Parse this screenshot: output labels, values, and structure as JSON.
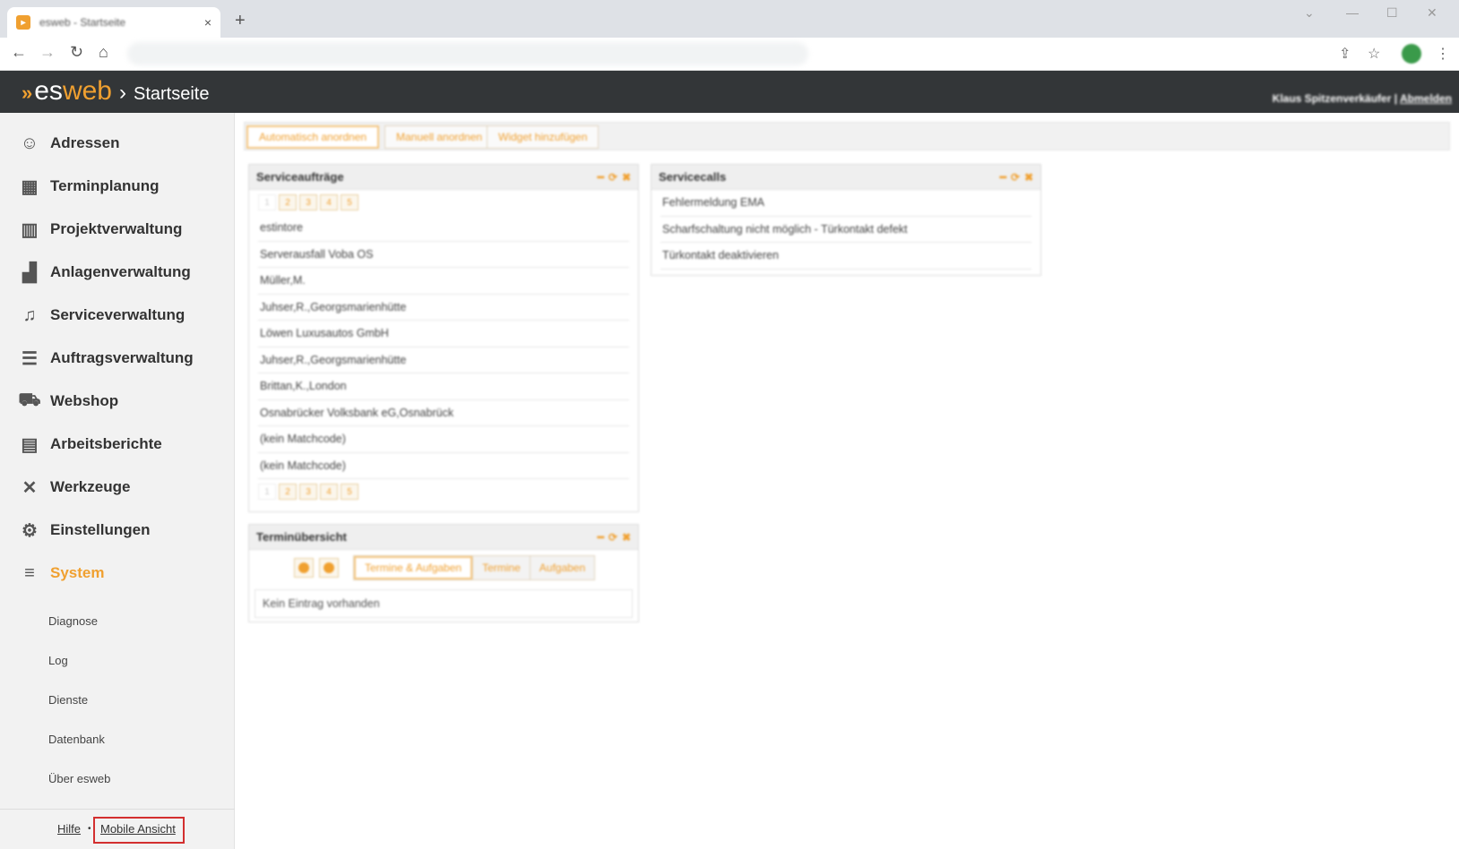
{
  "browser": {
    "tab_title": "esweb - Startseite",
    "tab_close": "×",
    "new_tab": "+",
    "win_controls": [
      "⌄",
      "—",
      "☐",
      "✕"
    ],
    "nav": {
      "back": "←",
      "forward": "→",
      "reload": "↻",
      "home": "⌂"
    },
    "toolbar_icons": [
      "⇪",
      "☆",
      "⋮"
    ]
  },
  "header": {
    "logo_arrow": "»",
    "logo_es": "es",
    "logo_web": "web",
    "separator": "›",
    "title": "Startseite",
    "user": "Klaus Spitzenverkäufer",
    "user_sep": " | ",
    "logout": "Abmelden"
  },
  "sidebar": {
    "items": [
      {
        "label": "Adressen",
        "icon": "☺"
      },
      {
        "label": "Terminplanung",
        "icon": "▦"
      },
      {
        "label": "Projektverwaltung",
        "icon": "▥"
      },
      {
        "label": "Anlagenverwaltung",
        "icon": "▟"
      },
      {
        "label": "Serviceverwaltung",
        "icon": "♫"
      },
      {
        "label": "Auftragsverwaltung",
        "icon": "☰"
      },
      {
        "label": "Webshop",
        "icon": "⛟"
      },
      {
        "label": "Arbeitsberichte",
        "icon": "▤"
      },
      {
        "label": "Werkzeuge",
        "icon": "✕"
      },
      {
        "label": "Einstellungen",
        "icon": "⚙"
      },
      {
        "label": "System",
        "icon": "≡"
      }
    ],
    "subitems": [
      "Diagnose",
      "Log",
      "Dienste",
      "Datenbank",
      "Über esweb"
    ],
    "footer": {
      "help": "Hilfe",
      "dot": "•",
      "mobile": "Mobile Ansicht"
    }
  },
  "actions": [
    "Automatisch anordnen",
    "Manuell anordnen",
    "Widget hinzufügen"
  ],
  "widget_controls": [
    "━",
    "⟳",
    "✖"
  ],
  "pager": [
    "1",
    "2",
    "3",
    "4",
    "5"
  ],
  "serviceauftraege": {
    "title": "Serviceaufträge",
    "rows": [
      "estintore",
      "Serverausfall Voba OS",
      "Müller,M.",
      "Juhser,R.,Georgsmarienhütte",
      "Löwen Luxusautos GmbH",
      "Juhser,R.,Georgsmarienhütte",
      "Brittan,K.,London",
      "Osnabrücker Volksbank eG,Osnabrück",
      "(kein Matchcode)",
      "(kein Matchcode)"
    ]
  },
  "servicecalls": {
    "title": "Servicecalls",
    "rows": [
      "Fehlermeldung EMA",
      "Scharfschaltung nicht möglich - Türkontakt defekt",
      "Türkontakt deaktivieren"
    ]
  },
  "termine": {
    "title": "Terminübersicht",
    "toggles": [
      "Termine & Aufgaben",
      "Termine",
      "Aufgaben"
    ],
    "empty": "Kein Eintrag vorhanden"
  }
}
